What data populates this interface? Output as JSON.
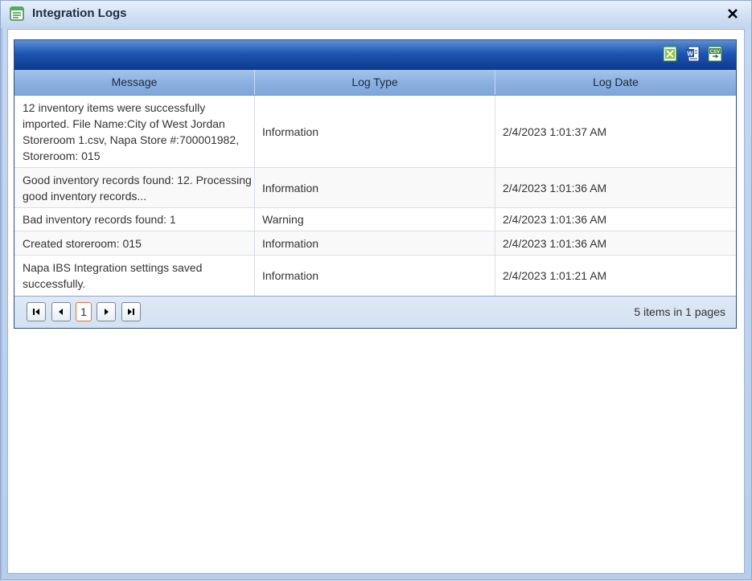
{
  "window": {
    "title": "Integration Logs",
    "icon": "list-icon",
    "close_icon": "close-icon"
  },
  "toolbar": {
    "export_buttons": [
      {
        "name": "export-excel-button",
        "icon": "excel-icon"
      },
      {
        "name": "export-word-button",
        "icon": "word-icon"
      },
      {
        "name": "export-csv-button",
        "icon": "csv-icon",
        "icon_text": "CSV"
      }
    ]
  },
  "grid": {
    "columns": [
      "Message",
      "Log Type",
      "Log Date"
    ],
    "rows": [
      {
        "message": "12 inventory items were successfully imported. File Name:City of West Jordan Storeroom 1.csv, Napa Store #:700001982, Storeroom: 015",
        "type": "Information",
        "date": "2/4/2023 1:01:37 AM"
      },
      {
        "message": "Good inventory records found: 12. Processing good inventory records...",
        "type": "Information",
        "date": "2/4/2023 1:01:36 AM"
      },
      {
        "message": "Bad inventory records found: 1",
        "type": "Warning",
        "date": "2/4/2023 1:01:36 AM"
      },
      {
        "message": "Created storeroom: 015",
        "type": "Information",
        "date": "2/4/2023 1:01:36 AM"
      },
      {
        "message": "Napa IBS Integration settings saved successfully.",
        "type": "Information",
        "date": "2/4/2023 1:01:21 AM"
      }
    ]
  },
  "pager": {
    "current_page": "1",
    "info": "5 items in 1 pages",
    "buttons": [
      "first-page-icon",
      "prev-page-icon",
      "next-page-icon",
      "last-page-icon"
    ]
  },
  "colors": {
    "toolbar_dark": "#0c3a8d",
    "header_blue": "#8bb1e2",
    "current_page_border": "#d9792f"
  }
}
